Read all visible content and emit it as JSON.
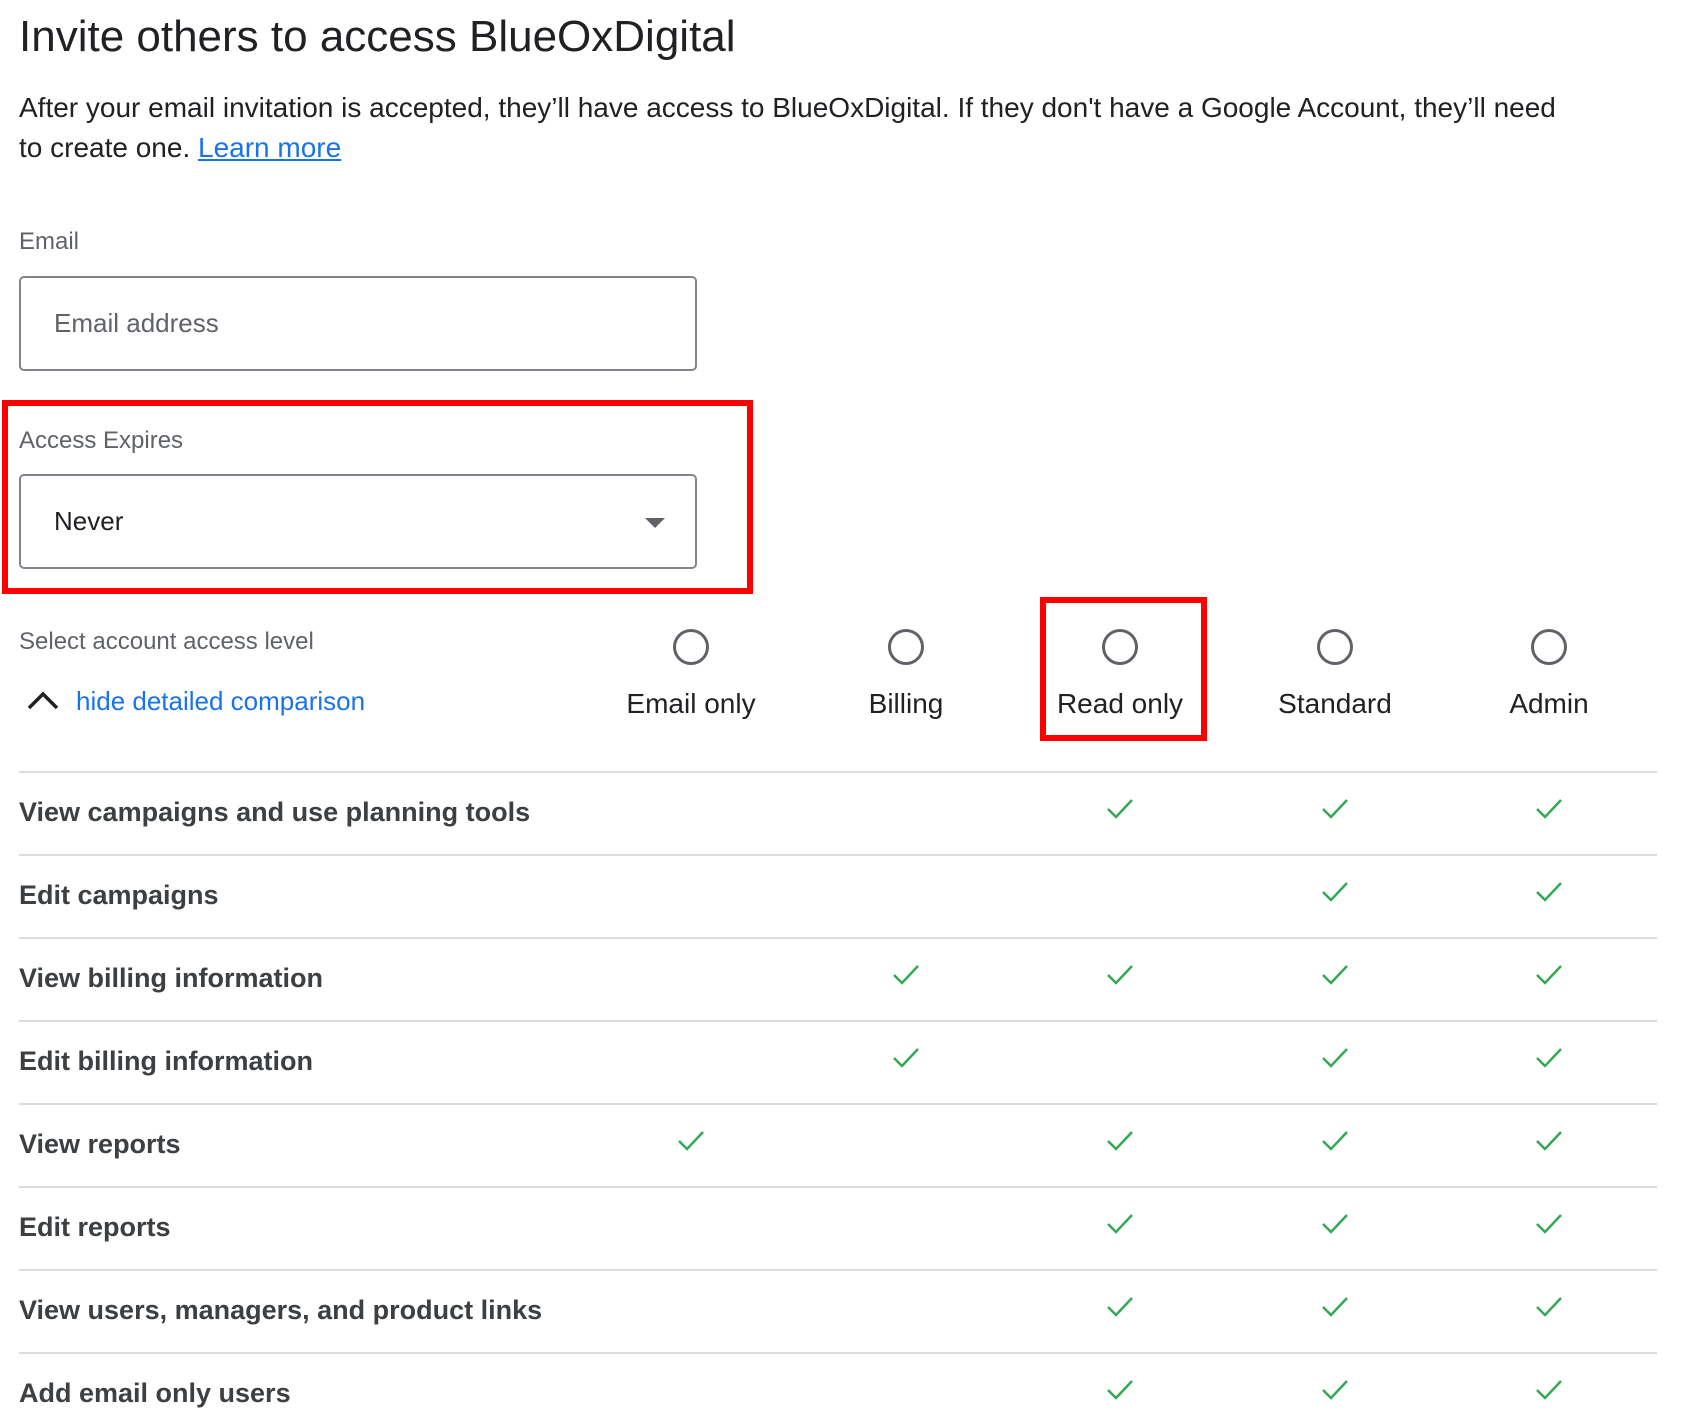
{
  "title": "Invite others to access BlueOxDigital",
  "description": "After your email invitation is accepted, they’ll have access to BlueOxDigital. If they don't have a Google Account, they’ll need to create one.",
  "learn_more": "Learn more",
  "email": {
    "label": "Email",
    "placeholder": "Email address",
    "value": ""
  },
  "access_expires": {
    "label": "Access Expires",
    "value": "Never"
  },
  "access_level": {
    "label": "Select account access level",
    "toggle": "hide detailed comparison",
    "options": [
      "Email only",
      "Billing",
      "Read only",
      "Standard",
      "Admin"
    ],
    "selected": null,
    "highlighted": "Read only"
  },
  "comparison": [
    {
      "feature": "View campaigns and use planning tools",
      "access": [
        false,
        false,
        true,
        true,
        true
      ]
    },
    {
      "feature": "Edit campaigns",
      "access": [
        false,
        false,
        false,
        true,
        true
      ]
    },
    {
      "feature": "View billing information",
      "access": [
        false,
        true,
        true,
        true,
        true
      ]
    },
    {
      "feature": "Edit billing information",
      "access": [
        false,
        true,
        false,
        true,
        true
      ]
    },
    {
      "feature": "View reports",
      "access": [
        true,
        false,
        true,
        true,
        true
      ]
    },
    {
      "feature": "Edit reports",
      "access": [
        false,
        false,
        true,
        true,
        true
      ]
    },
    {
      "feature": "View users, managers, and product links",
      "access": [
        false,
        false,
        true,
        true,
        true
      ]
    },
    {
      "feature": "Add email only users",
      "access": [
        false,
        false,
        true,
        true,
        true
      ]
    }
  ],
  "colors": {
    "check": "#34a853",
    "link": "#1a73e8",
    "highlight": "#ff0000"
  }
}
